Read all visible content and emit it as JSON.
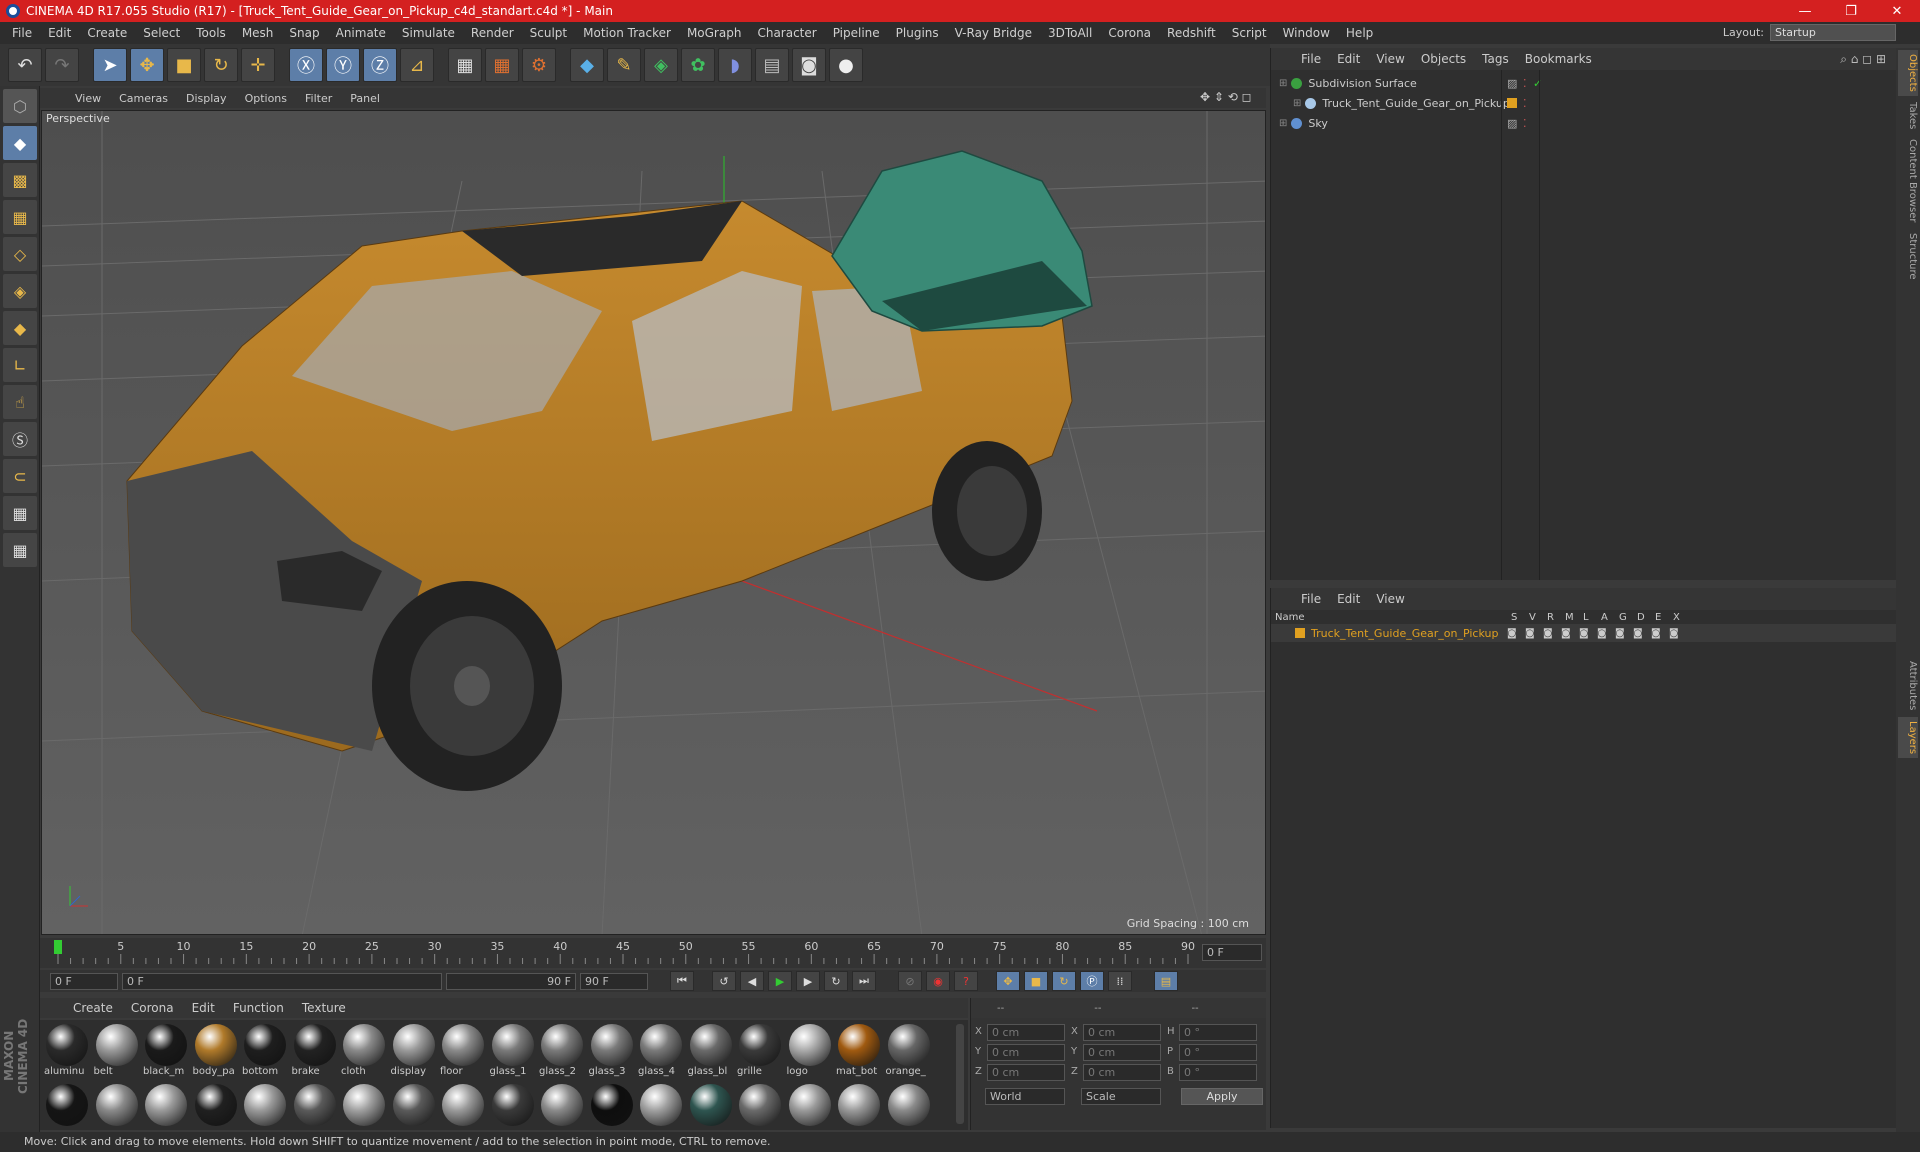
{
  "window": {
    "title": "CINEMA 4D R17.055 Studio (R17) - [Truck_Tent_Guide_Gear_on_Pickup_c4d_standart.c4d *] - Main",
    "minimize": "—",
    "maximize": "❐",
    "close": "✕"
  },
  "menu": [
    "File",
    "Edit",
    "Create",
    "Select",
    "Tools",
    "Mesh",
    "Snap",
    "Animate",
    "Simulate",
    "Render",
    "Sculpt",
    "Motion Tracker",
    "MoGraph",
    "Character",
    "Pipeline",
    "Plugins",
    "V-Ray Bridge",
    "3DToAll",
    "Corona",
    "Redshift",
    "Script",
    "Window",
    "Help"
  ],
  "layout": {
    "label": "Layout:",
    "value": "Startup"
  },
  "viewport": {
    "menu": [
      "View",
      "Cameras",
      "Display",
      "Options",
      "Filter",
      "Panel"
    ],
    "camera": "Perspective",
    "grid_spacing": "Grid Spacing : 100 cm"
  },
  "timeline": {
    "ticks": [
      "0",
      "5",
      "10",
      "15",
      "20",
      "25",
      "30",
      "35",
      "40",
      "45",
      "50",
      "55",
      "60",
      "65",
      "70",
      "75",
      "80",
      "85",
      "90"
    ],
    "current_frame": "0 F",
    "start": "0 F",
    "range_start": "0 F",
    "range_end": "90 F",
    "end": "90 F"
  },
  "material_menu": [
    "Create",
    "Corona",
    "Edit",
    "Function",
    "Texture"
  ],
  "materials_row1": [
    {
      "name": "aluminu",
      "color": "#2a2a2a"
    },
    {
      "name": "belt",
      "color": "#9a9a9a"
    },
    {
      "name": "black_m",
      "color": "#1a1a1a"
    },
    {
      "name": "body_pa",
      "color": "#b07a2a"
    },
    {
      "name": "bottom",
      "color": "#1e1e1e"
    },
    {
      "name": "brake",
      "color": "#222222"
    },
    {
      "name": "cloth",
      "color": "#8a8a8a"
    },
    {
      "name": "display",
      "color": "#9a9a9a"
    },
    {
      "name": "floor",
      "color": "#8a8a8a"
    },
    {
      "name": "glass_1",
      "color": "#7a7a7a"
    },
    {
      "name": "glass_2",
      "color": "#7a7a7a"
    },
    {
      "name": "glass_3",
      "color": "#7a7a7a"
    },
    {
      "name": "glass_4",
      "color": "#7a7a7a"
    },
    {
      "name": "glass_bl",
      "color": "#6a6a6a"
    },
    {
      "name": "grille",
      "color": "#3a3a3a"
    },
    {
      "name": "logo",
      "color": "#aaaaaa"
    },
    {
      "name": "mat_bot",
      "color": "#a05a10"
    },
    {
      "name": "orange_",
      "color": "#666666"
    }
  ],
  "materials_row2": [
    "#151515",
    "#8a8a8a",
    "#9a9a9a",
    "#202020",
    "#9a9a9a",
    "#5a5a5a",
    "#a0a0a0",
    "#5a5a5a",
    "#9a9a9a",
    "#3a3a3a",
    "#8a8a8a",
    "#0e0e0e",
    "#a0a0a0",
    "#2e5550",
    "#6a6a6a",
    "#9a9a9a",
    "#9a9a9a",
    "#8a8a8a"
  ],
  "coordinates": {
    "headers": [
      "--",
      "--",
      "--"
    ],
    "rows": [
      {
        "a": "X",
        "av": "0 cm",
        "b": "X",
        "bv": "0 cm",
        "c": "H",
        "cv": "0 °"
      },
      {
        "a": "Y",
        "av": "0 cm",
        "b": "Y",
        "bv": "0 cm",
        "c": "P",
        "cv": "0 °"
      },
      {
        "a": "Z",
        "av": "0 cm",
        "b": "Z",
        "bv": "0 cm",
        "c": "B",
        "cv": "0 °"
      }
    ],
    "world": "World",
    "scale": "Scale",
    "apply": "Apply"
  },
  "objects": {
    "menu": [
      "File",
      "Edit",
      "View",
      "Objects",
      "Tags",
      "Bookmarks"
    ],
    "items": [
      {
        "name": "Subdivision Surface",
        "indent": 0,
        "icon_color": "#3aa040"
      },
      {
        "name": "Truck_Tent_Guide_Gear_on_Pickup",
        "indent": 1,
        "icon_color": "#a8c8e8"
      },
      {
        "name": "Sky",
        "indent": 0,
        "icon_color": "#6090d0"
      }
    ]
  },
  "layers": {
    "menu": [
      "File",
      "Edit",
      "View"
    ],
    "columns": [
      "Name",
      "S",
      "V",
      "R",
      "M",
      "L",
      "A",
      "G",
      "D",
      "E",
      "X"
    ],
    "items": [
      {
        "name": "Truck_Tent_Guide_Gear_on_Pickup",
        "color": "#e0a020"
      }
    ]
  },
  "side_tabs": [
    "Objects",
    "Takes",
    "Content Browser",
    "Structure"
  ],
  "side_tabs_lower": [
    "Attributes",
    "Layers"
  ],
  "status": "Move: Click and drag to move elements. Hold down SHIFT to quantize movement / add to the selection in point mode, CTRL to remove.",
  "branding": "MAXON CINEMA 4D"
}
